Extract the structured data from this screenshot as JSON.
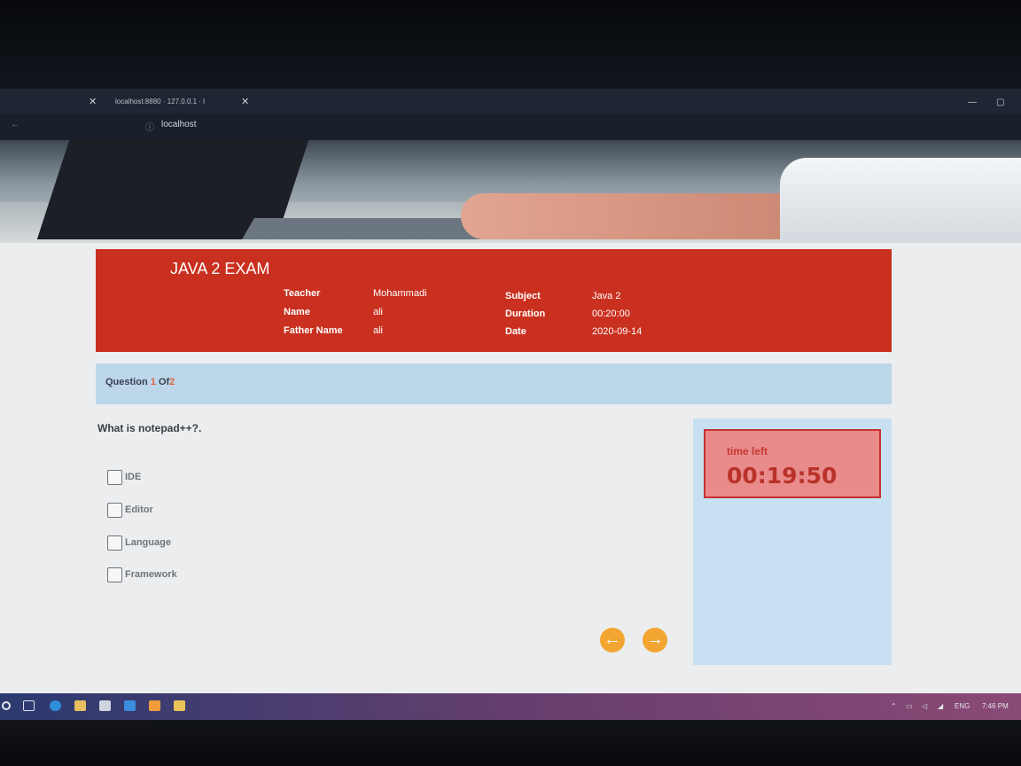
{
  "browser": {
    "tab_title": "localhost:8880 · 127.0.0.1 · l",
    "address": "localhost"
  },
  "exam": {
    "title": "JAVA 2 EXAM",
    "info": [
      {
        "label": "Teacher",
        "value": "Mohammadi"
      },
      {
        "label": "Name",
        "value": "ali"
      },
      {
        "label": "Father Name",
        "value": "ali"
      },
      {
        "label": "Subject",
        "value": "Java 2"
      },
      {
        "label": "Duration",
        "value": "00:20:00"
      },
      {
        "label": "Date",
        "value": "2020-09-14"
      }
    ]
  },
  "question_bar": {
    "prefix": "Question",
    "current": "1",
    "of": "Of",
    "total": "2"
  },
  "question": {
    "text": "What is notepad++?.",
    "options": [
      "IDE",
      "Editor",
      "Language",
      "Framework"
    ]
  },
  "navigation": {
    "prev_icon": "arrow-left-icon",
    "next_icon": "arrow-right-icon"
  },
  "timer": {
    "label": "time left",
    "value": "00:19:50"
  },
  "taskbar": {
    "language": "ENG",
    "time": "7:46 PM"
  },
  "colors": {
    "header_red": "#c9301f",
    "question_bar": "#bcd6ea",
    "timer_bg": "#e98b8b",
    "nav_orange": "#f2a531"
  }
}
